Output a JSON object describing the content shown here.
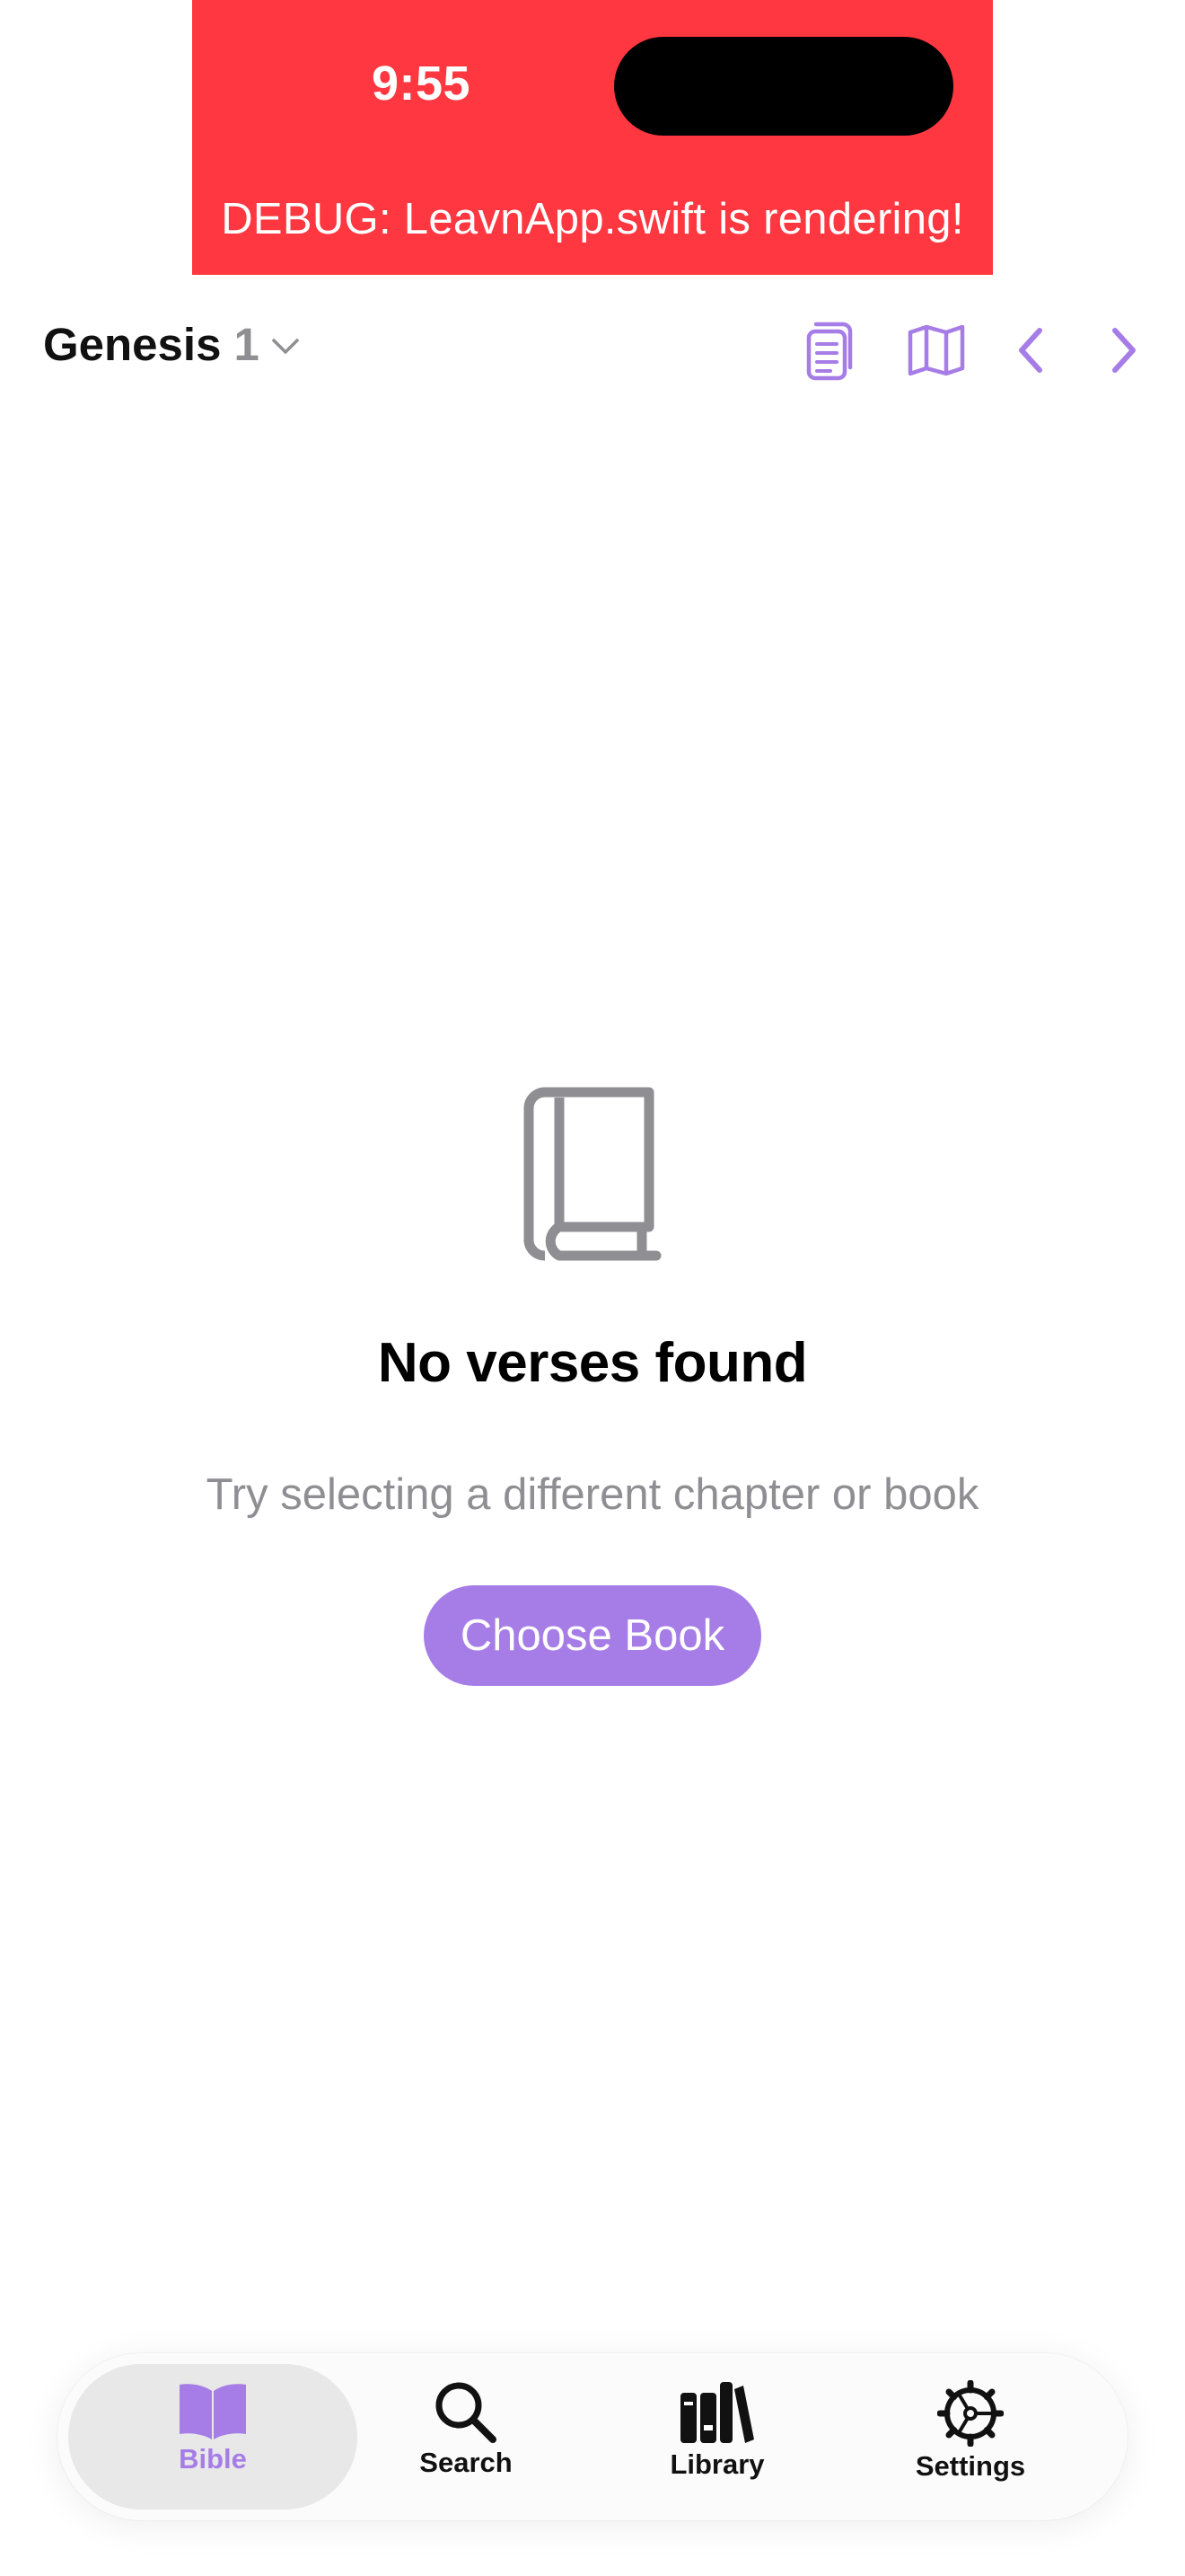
{
  "status_bar": {
    "time": "9:55"
  },
  "debug_banner": {
    "text": "DEBUG: LeavnApp.swift is rendering!",
    "color": "#fe3740"
  },
  "header": {
    "book": "Genesis",
    "chapter": "1",
    "actions": [
      {
        "icon": "document-icon"
      },
      {
        "icon": "map-icon"
      },
      {
        "icon": "chevron-left-icon"
      },
      {
        "icon": "chevron-right-icon"
      }
    ]
  },
  "empty_state": {
    "icon": "book-icon",
    "title": "No verses found",
    "subtitle": "Try selecting a different chapter or book",
    "button_label": "Choose Book"
  },
  "tab_bar": {
    "selected": "Bible",
    "tabs": [
      {
        "label": "Bible",
        "icon": "open-book-icon"
      },
      {
        "label": "Search",
        "icon": "magnifier-icon"
      },
      {
        "label": "Library",
        "icon": "books-icon"
      },
      {
        "label": "Settings",
        "icon": "gear-icon"
      }
    ]
  },
  "colors": {
    "accent": "#a67de6",
    "secondary_text": "#8e8e93",
    "debug_red": "#fe3740"
  }
}
